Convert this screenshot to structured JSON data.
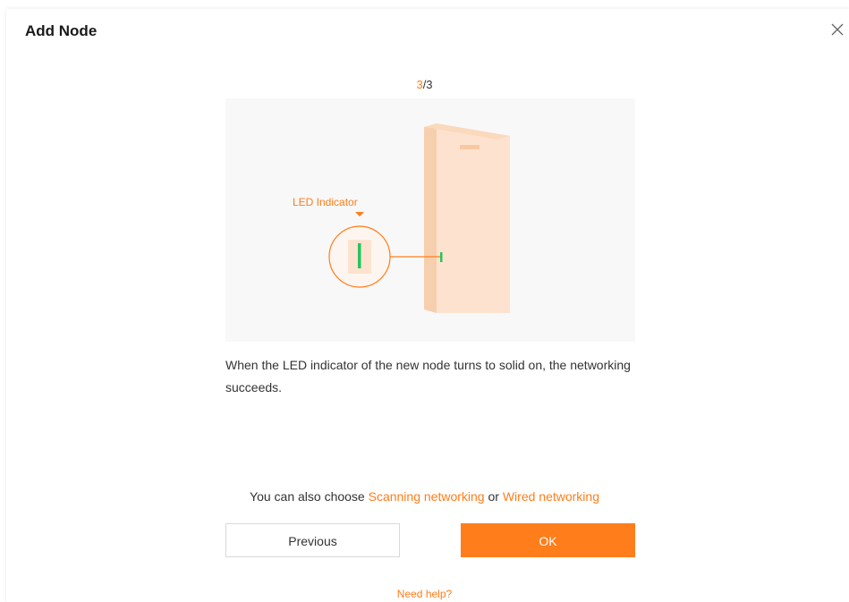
{
  "dialog": {
    "title": "Add Node",
    "close_icon": "close-icon"
  },
  "step": {
    "current": "3",
    "total": "/3"
  },
  "illustration": {
    "led_label": "LED Indicator",
    "led_color": "#22c55e",
    "device_color": "#fde3cf",
    "accent": "#ff7d1a"
  },
  "description": "When the LED indicator of the new node turns to solid on, the networking succeeds.",
  "alternatives": {
    "prefix": "You can also choose ",
    "scanning": "Scanning networking",
    "or": " or ",
    "wired": "Wired networking"
  },
  "buttons": {
    "previous": "Previous",
    "ok": "OK"
  },
  "help_link": "Need help?"
}
